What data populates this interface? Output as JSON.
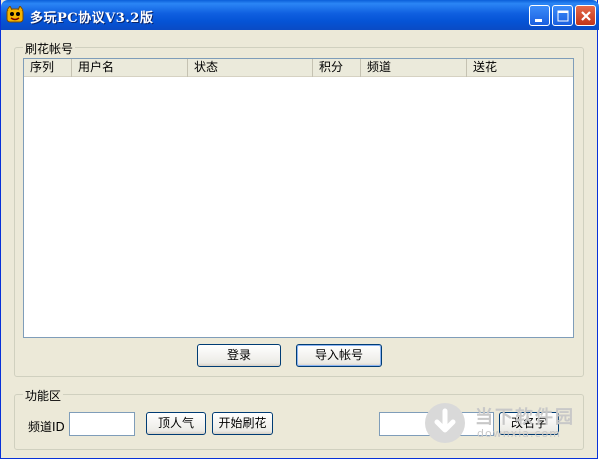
{
  "window": {
    "title": "多玩PC协议V3.2版"
  },
  "accounts_group": {
    "title": "刷花帐号",
    "columns": [
      "序列",
      "用户名",
      "状态",
      "积分",
      "频道",
      "送花"
    ],
    "rows": [],
    "login_label": "登录",
    "import_label": "导入帐号"
  },
  "function_group": {
    "title": "功能区",
    "channel_id_label": "频道ID",
    "channel_id_value": "",
    "boost_label": "顶人气",
    "start_flowers_label": "开始刷花",
    "rename_value": "",
    "rename_label": "改名字"
  },
  "watermark": {
    "text": "当下软件园",
    "domain": "downxia.com"
  },
  "colors": {
    "titlebar": "#0554d6",
    "window_bg": "#ece9d8",
    "close_button": "#c2351a"
  }
}
